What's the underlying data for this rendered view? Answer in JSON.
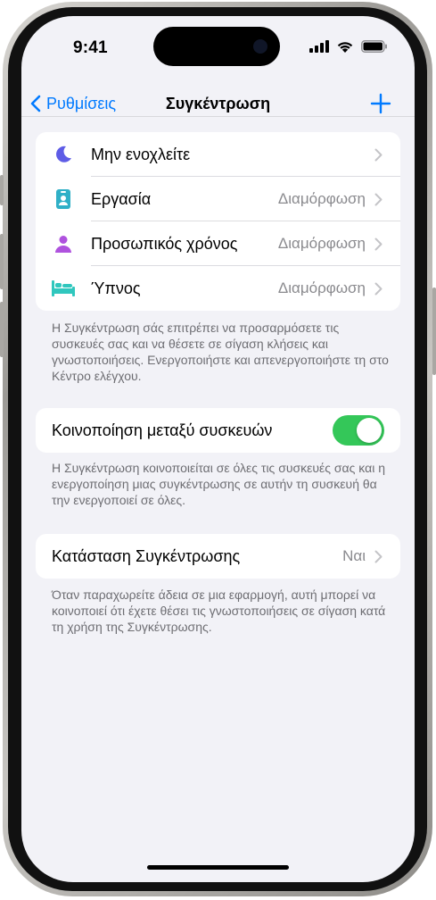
{
  "status_bar": {
    "time": "9:41"
  },
  "nav": {
    "back_label": "Ρυθμίσεις",
    "title": "Συγκέντρωση"
  },
  "focus_modes": [
    {
      "label": "Μην ενοχλείτε",
      "value": "",
      "icon": "moon-icon",
      "color": "#5e5ce6"
    },
    {
      "label": "Εργασία",
      "value": "Διαμόρφωση",
      "icon": "id-badge-icon",
      "color": "#30b0c7"
    },
    {
      "label": "Προσωπικός χρόνος",
      "value": "Διαμόρφωση",
      "icon": "person-icon",
      "color": "#af52de"
    },
    {
      "label": "Ύπνος",
      "value": "Διαμόρφωση",
      "icon": "bed-icon",
      "color": "#30c7be"
    }
  ],
  "focus_footer": "Η Συγκέντρωση σάς επιτρέπει να προσαρμόσετε τις συσκευές σας και να θέσετε σε σίγαση κλήσεις και γνωστοποιήσεις. Ενεργοποιήστε και απενεργοποιήστε τη στο Κέντρο ελέγχου.",
  "share": {
    "label": "Κοινοποίηση μεταξύ συσκευών",
    "enabled": true,
    "footer": "Η Συγκέντρωση κοινοποιείται σε όλες τις συσκευές σας και η ενεργοποίηση μιας συγκέντρωσης σε αυτήν τη συσκευή θα την ενεργοποιεί σε όλες."
  },
  "focus_status": {
    "label": "Κατάσταση Συγκέντρωσης",
    "value": "Ναι",
    "footer": "Όταν παραχωρείτε άδεια σε μια εφαρμογή, αυτή μπορεί να κοινοποιεί ότι έχετε θέσει τις γνωστοποιήσεις σε σίγαση κατά τη χρήση της Συγκέντρωσης."
  },
  "colors": {
    "accent": "#007aff",
    "toggle_on": "#34c759",
    "background": "#f2f2f7"
  }
}
